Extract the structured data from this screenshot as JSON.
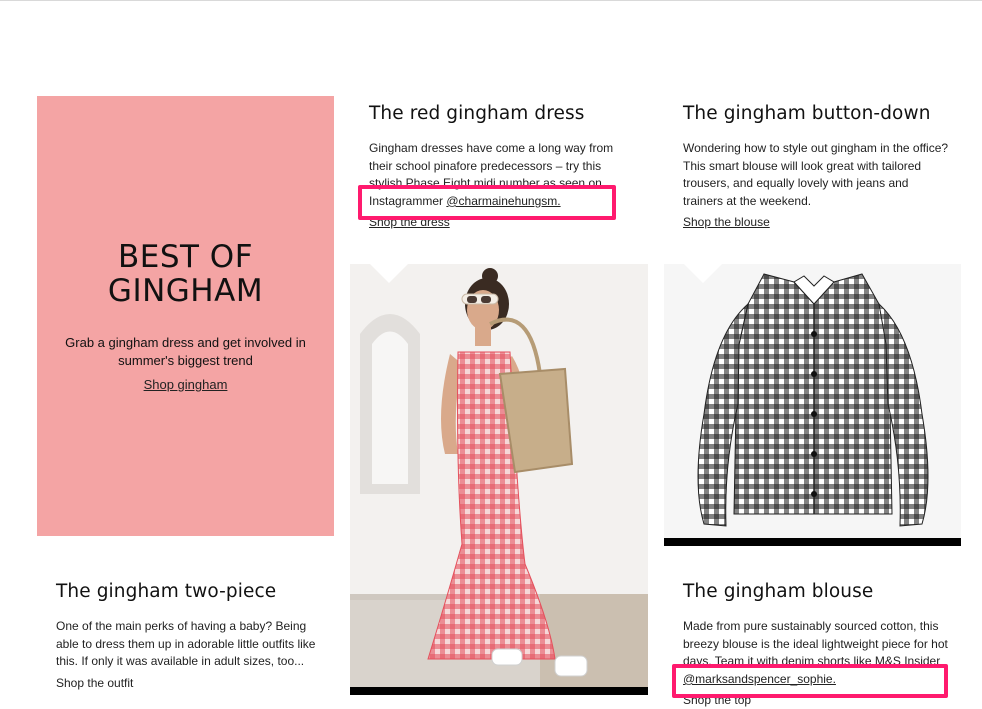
{
  "hero": {
    "title": "BEST OF GINGHAM",
    "text": "Grab a gingham dress and get involved in summer's biggest trend",
    "link": "Shop gingham"
  },
  "articles": [
    {
      "title": "The red gingham dress",
      "body": "Gingham dresses have come a long way from their school pinafore predecessors – try this stylish Phase Eight midi number as seen on Instagrammer ",
      "handle": "@charmainehungsm.",
      "link": "Shop the dress"
    },
    {
      "title": "The gingham button-down",
      "body": "Wondering how to style out gingham in the office? This smart blouse will look great with tailored trousers, and equally lovely with jeans and trainers at the weekend.",
      "link": "Shop the blouse"
    },
    {
      "title": "The gingham two-piece",
      "body": "One of the main perks of having a baby? Being able to dress them up in adorable little outfits like this. If only it was available in adult sizes, too...",
      "link": "Shop the outfit"
    },
    {
      "title": "The gingham blouse",
      "body": "Made from pure sustainably sourced cotton, this breezy blouse is the ideal lightweight piece for hot days. Team it with denim shorts like M&S Insider ",
      "handle": "@marksandspencer_sophie.",
      "link": "Shop the top"
    }
  ],
  "colors": {
    "hero_bg": "#f4a4a4",
    "highlight": "#ff1a6e",
    "gingham_red": "#e4505c",
    "gingham_black": "#1d1d1d"
  }
}
